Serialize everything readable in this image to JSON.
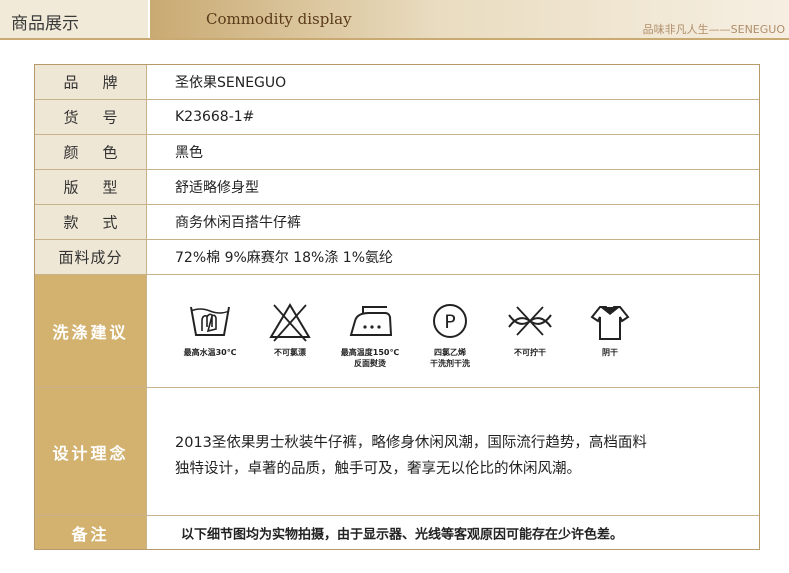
{
  "header": {
    "section_cn": "商品展示",
    "section_en": "Commodity display",
    "slogan": "品味非凡人生——SENEGUO"
  },
  "specs": [
    {
      "label": "品牌",
      "value": "圣依果SENEGUO"
    },
    {
      "label": "货号",
      "value": "K23668-1#"
    },
    {
      "label": "颜色",
      "value": "黑色"
    },
    {
      "label": "版型",
      "value": "舒适略修身型"
    },
    {
      "label": "款式",
      "value": "商务休闲百搭牛仔裤"
    },
    {
      "label": "面料成分",
      "value": "72%棉  9%麻赛尔  18%涤  1%氨纶"
    }
  ],
  "care": {
    "label": "洗涤建议",
    "items": [
      {
        "icon": "wash-30-icon",
        "caption": "最高水温30℃"
      },
      {
        "icon": "no-bleach-icon",
        "caption": "不可氯漂"
      },
      {
        "icon": "iron-150-icon",
        "caption": "最高温度150℃\n反面熨烫"
      },
      {
        "icon": "dry-clean-p-icon",
        "caption": "四氯乙烯\n干洗剂干洗"
      },
      {
        "icon": "no-wring-icon",
        "caption": "不可拧干"
      },
      {
        "icon": "shade-dry-icon",
        "caption": "阴干"
      }
    ]
  },
  "design": {
    "label": "设计理念",
    "line1": "2013圣依果男士秋装牛仔裤，略修身休闲风潮，国际流行趋势，高档面料",
    "line2": "独特设计，卓著的品质，触手可及，奢享无以伦比的休闲风潮。"
  },
  "note": {
    "label": "备注",
    "text": "以下细节图均为实物拍摄，由于显示器、光线等客观原因可能存在少许色差。"
  }
}
